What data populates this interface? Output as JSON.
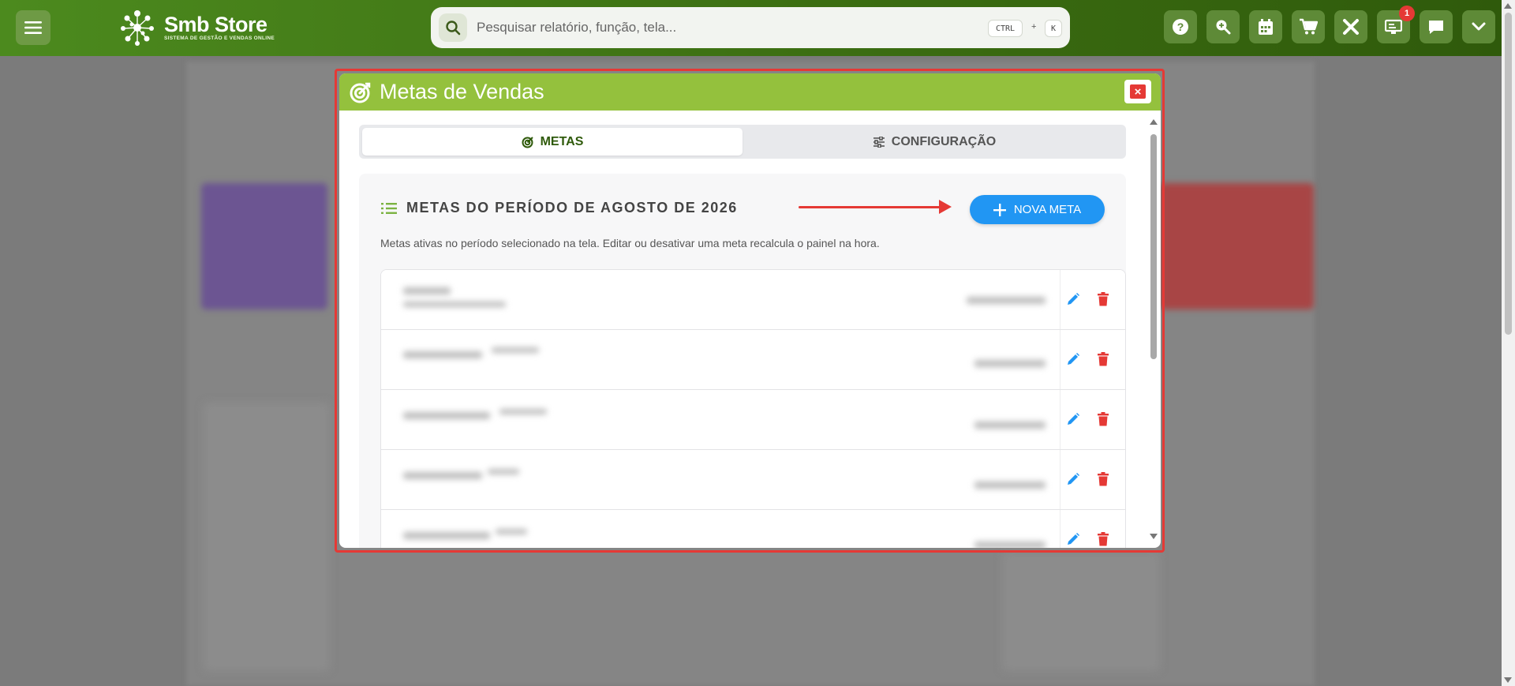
{
  "topbar": {
    "brand": "Smb Store",
    "tagline": "SISTEMA DE GESTÃO E VENDAS ONLINE",
    "search_placeholder": "Pesquisar relatório, função, tela...",
    "kbd_ctrl": "CTRL",
    "kbd_plus": "+",
    "kbd_k": "K",
    "notification_count": "1",
    "tools": [
      "help-icon",
      "zoom-search-icon",
      "calendar-icon",
      "cart-icon",
      "tools-icon",
      "monitor-icon",
      "chat-icon",
      "chevron-down-icon"
    ]
  },
  "modal": {
    "title": "Metas de Vendas",
    "close_label": "×",
    "tabs": [
      {
        "label": "METAS",
        "icon": "target-icon",
        "active": true
      },
      {
        "label": "CONFIGURAÇÃO",
        "icon": "sliders-icon",
        "active": false
      }
    ],
    "section": {
      "title": "METAS DO PERÍODO DE AGOSTO DE 2026",
      "description": "Metas ativas no período selecionado na tela. Editar ou desativar uma meta recalcula o painel na hora.",
      "new_button": "NOVA META"
    },
    "rows_count": 5
  },
  "colors": {
    "brand_green": "#94c13d",
    "topbar_green": "#3c6e12",
    "primary_blue": "#2196f3",
    "danger_red": "#e53935"
  }
}
